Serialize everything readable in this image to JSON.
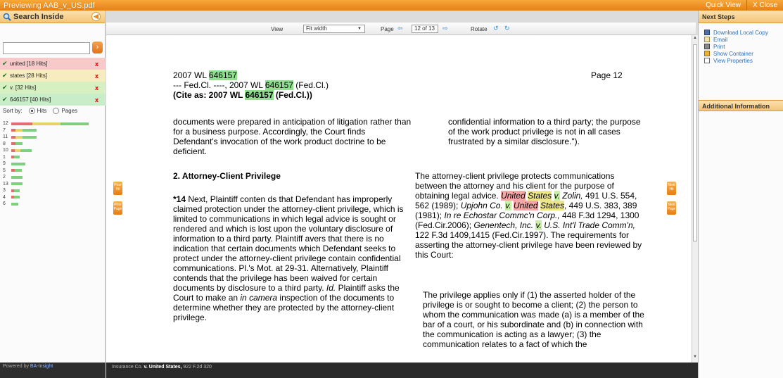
{
  "window": {
    "title": "Previewing AAB_v_US.pdf",
    "quick_view": "Quick View",
    "close": "X Close"
  },
  "search": {
    "title": "Search Inside",
    "placeholder": "",
    "hits": [
      {
        "label": "united [18 Hits]",
        "color": "#f7c9c9"
      },
      {
        "label": "states [28 Hits]",
        "color": "#f6ecc0"
      },
      {
        "label": "v. [32 Hits]",
        "color": "#d7f0c2"
      },
      {
        "label": "646157 [40 Hits]",
        "color": "#c9ecc9"
      }
    ],
    "sort_label": "Sort by:",
    "sort_hits": "Hits",
    "sort_pages": "Pages",
    "page_bars": [
      {
        "page": "12",
        "red": 30,
        "yellow": 40,
        "green": 40
      },
      {
        "page": "7",
        "red": 6,
        "yellow": 10,
        "green": 20
      },
      {
        "page": "11",
        "red": 6,
        "yellow": 10,
        "green": 20
      },
      {
        "page": "8",
        "red": 6,
        "yellow": 0,
        "green": 10
      },
      {
        "page": "10",
        "red": 5,
        "yellow": 8,
        "green": 16
      },
      {
        "page": "1",
        "red": 4,
        "yellow": 0,
        "green": 8
      },
      {
        "page": "9",
        "red": 0,
        "yellow": 0,
        "green": 20
      },
      {
        "page": "5",
        "red": 5,
        "yellow": 0,
        "green": 10
      },
      {
        "page": "2",
        "red": 0,
        "yellow": 0,
        "green": 16
      },
      {
        "page": "13",
        "red": 0,
        "yellow": 0,
        "green": 16
      },
      {
        "page": "3",
        "red": 4,
        "yellow": 0,
        "green": 8
      },
      {
        "page": "4",
        "red": 4,
        "yellow": 0,
        "green": 8
      },
      {
        "page": "6",
        "red": 0,
        "yellow": 0,
        "green": 10
      }
    ],
    "powered_label": "Powered by",
    "powered_brand": "BA-Insight"
  },
  "toolbar": {
    "view_label": "View",
    "view_value": "Fit width",
    "page_label": "Page",
    "page_value": "12 of 13",
    "rotate_label": "Rotate"
  },
  "nav": {
    "prior_hit": "Prior Hit",
    "prior_page": "Prior Page",
    "next_hit": "Next Hit",
    "next_page": "Next Page"
  },
  "doc": {
    "cite_prefix": "2007 WL ",
    "cite_num": "646157",
    "line2_a": "--- Fed.Cl. ----, 2007 WL ",
    "line2_b": " (Fed.Cl.)",
    "line3_a": "(Cite as: 2007 WL ",
    "line3_b": " (Fed.Cl.))",
    "page_label": "Page 12",
    "left_p1": "documents were prepared in anticipation of litigation rather than for a business purpose. Accordingly, the Court finds Defendant's invocation of the work product doctrine to be deficient.",
    "right_p1": "confidential information to a third party; the purpose of the work product privilege is not in all cases frustrated by a similar disclosure.\").",
    "heading": "2. Attorney-Client Privilege",
    "star": "*14",
    "left_p2_a": " Next, Plaintiff conten  ds that Defendant has improperly claimed protection under the attorney-client privilege, which is limited to communications in which legal advice is sought or rendered and which is lost upon the voluntary disclosure of information to a third party. Plaintiff avers that there is no indication that certain documents which Defendant seeks to protect under the attorney-client privilege contain confidential communications. Pl.'s Mot. at 29-31. Alternatively, Plaintiff contends that the privilege has been waived for certain documents by disclosure to a third party. ",
    "left_p2_id": "Id.",
    "left_p2_b": " Plaintiff asks the Court to make an ",
    "left_p2_cam": "in camera",
    "left_p2_c": " inspection of the documents to determine whether they are protected by the attorney-client privilege.",
    "r_a": "The attorney-client privilege protects communications between the attorney and his client for the purpose of obtaining legal advice.  ",
    "r_united": "United",
    "r_states": "States",
    "r_v": "v.",
    "r_zolin": " Zolin,",
    "r_b": " 491 U.S. 554, 562 (1989); ",
    "r_upjohn": "Upjohn Co.",
    "r_c": " 449 U.S. 383, 389 (1981); ",
    "r_inre": "In re Echostar Commc'n Corp.,",
    "r_d": " 448 F.3d 1294, 1300 (Fed.Cir.2006); ",
    "r_genentech": "Genentech, Inc.",
    "r_uss": " U.S. Int'l Trade Comm'n,",
    "r_e": " 122 F.3d 1409,1415 (Fed.Cir.1997). The requirements for asserting the attorney-client privilege have been reviewed by this Court:",
    "r_quote": "The privilege applies only if (1) the asserted holder of the privilege is or sought to become a client; (2) the person to whom the communication was made (a) is a member of the bar of a court, or his subordinate and (b) in connection with the communication is acting as a lawyer; (3) the communication relates to a fact of which the"
  },
  "next_steps": {
    "title": "Next Steps",
    "items": [
      "Download Local Copy",
      "Email",
      "Print",
      "Show Container",
      "View Properties"
    ],
    "additional": "Additional Information"
  },
  "footer": {
    "text_a": "Insurance Co. ",
    "text_b": "v. United States,",
    "text_c": " 922 F.2d 320"
  }
}
